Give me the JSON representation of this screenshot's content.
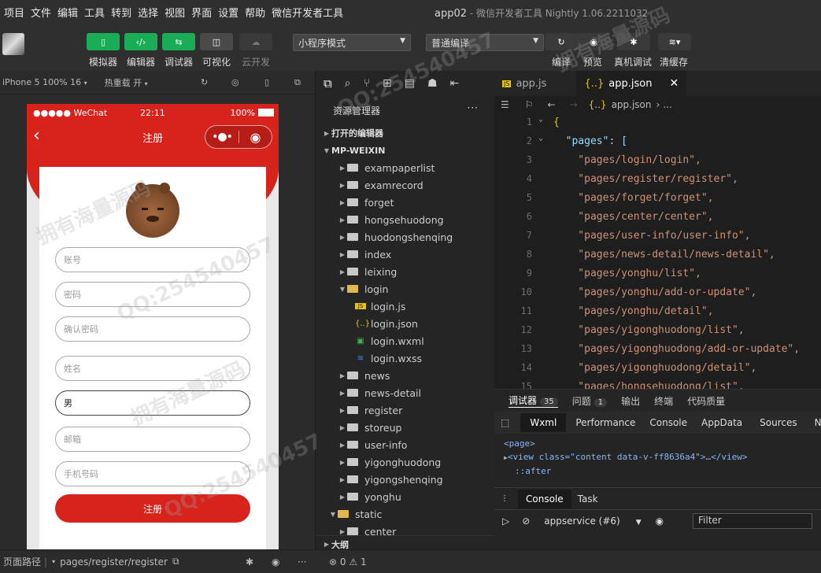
{
  "menu": [
    "项目",
    "文件",
    "编辑",
    "工具",
    "转到",
    "选择",
    "视图",
    "界面",
    "设置",
    "帮助",
    "微信开发者工具"
  ],
  "window_title": "app02",
  "window_subtitle": "- 微信开发者工具 Nightly 1.06.2211032",
  "toolbar": {
    "simulator": "模拟器",
    "editor": "编辑器",
    "debugger": "调试器",
    "visual": "可视化",
    "cloud": "云开发",
    "mode_select": "小程序模式",
    "compile_select": "普通编译",
    "compile": "编译",
    "preview": "预览",
    "real_debug": "真机调试",
    "clear_cache": "清缓存"
  },
  "simbar": {
    "device": "iPhone 5 100% 16",
    "hot_reload": "热重载 开"
  },
  "phone": {
    "carrier": "●●●●● WeChat",
    "time": "22:11",
    "battery": "100%",
    "page_title": "注册",
    "fields": [
      {
        "placeholder": "账号",
        "value": ""
      },
      {
        "placeholder": "密码",
        "value": ""
      },
      {
        "placeholder": "确认密码",
        "value": ""
      },
      {
        "placeholder": "姓名",
        "value": ""
      },
      {
        "placeholder": "",
        "value": "男"
      },
      {
        "placeholder": "邮箱",
        "value": ""
      },
      {
        "placeholder": "手机号码",
        "value": ""
      }
    ],
    "register_button": "注册"
  },
  "explorer": {
    "title": "资源管理器",
    "open_editors": "打开的编辑器",
    "root": "MP-WEIXIN",
    "outline": "大纲",
    "items": [
      {
        "name": "exampaperlist",
        "type": "folder",
        "level": 1
      },
      {
        "name": "examrecord",
        "type": "folder",
        "level": 1
      },
      {
        "name": "forget",
        "type": "folder",
        "level": 1
      },
      {
        "name": "hongsehuodong",
        "type": "folder",
        "level": 1
      },
      {
        "name": "huodongshenqing",
        "type": "folder",
        "level": 1
      },
      {
        "name": "index",
        "type": "folder",
        "level": 1
      },
      {
        "name": "leixing",
        "type": "folder",
        "level": 1
      },
      {
        "name": "login",
        "type": "folder-open",
        "level": 1
      },
      {
        "name": "login.js",
        "type": "js",
        "level": 2
      },
      {
        "name": "login.json",
        "type": "json",
        "level": 2
      },
      {
        "name": "login.wxml",
        "type": "wxml",
        "level": 2
      },
      {
        "name": "login.wxss",
        "type": "wxss",
        "level": 2
      },
      {
        "name": "news",
        "type": "folder",
        "level": 1
      },
      {
        "name": "news-detail",
        "type": "folder",
        "level": 1
      },
      {
        "name": "register",
        "type": "folder",
        "level": 1
      },
      {
        "name": "storeup",
        "type": "folder",
        "level": 1
      },
      {
        "name": "user-info",
        "type": "folder",
        "level": 1
      },
      {
        "name": "yigonghuodong",
        "type": "folder",
        "level": 1
      },
      {
        "name": "yigongshenqing",
        "type": "folder",
        "level": 1
      },
      {
        "name": "yonghu",
        "type": "folder",
        "level": 1
      },
      {
        "name": "static",
        "type": "folder-open",
        "level": 0
      },
      {
        "name": "center",
        "type": "folder",
        "level": 1
      }
    ]
  },
  "editor": {
    "tabs": [
      {
        "name": "app.js",
        "active": false
      },
      {
        "name": "app.json",
        "active": true
      }
    ],
    "breadcrumb": "app.json",
    "breadcrumb_tail": "...",
    "lines": [
      {
        "n": "1",
        "text": "{"
      },
      {
        "n": "2",
        "text": "  \"pages\": ["
      },
      {
        "n": "3",
        "text": "    \"pages/login/login\","
      },
      {
        "n": "4",
        "text": "    \"pages/register/register\","
      },
      {
        "n": "5",
        "text": "    \"pages/forget/forget\","
      },
      {
        "n": "6",
        "text": "    \"pages/center/center\","
      },
      {
        "n": "7",
        "text": "    \"pages/user-info/user-info\","
      },
      {
        "n": "8",
        "text": "    \"pages/news-detail/news-detail\","
      },
      {
        "n": "9",
        "text": "    \"pages/yonghu/list\","
      },
      {
        "n": "10",
        "text": "    \"pages/yonghu/add-or-update\","
      },
      {
        "n": "11",
        "text": "    \"pages/yonghu/detail\","
      },
      {
        "n": "12",
        "text": "    \"pages/yigonghuodong/list\","
      },
      {
        "n": "13",
        "text": "    \"pages/yigonghuodong/add-or-update\","
      },
      {
        "n": "14",
        "text": "    \"pages/yigonghuodong/detail\","
      },
      {
        "n": "15",
        "text": "    \"pages/hongsehuodong/list\","
      }
    ]
  },
  "debugger": {
    "tab_debugger": "调试器",
    "debugger_count": "35",
    "tab_issues": "问题",
    "issues_count": "1",
    "tab_output": "输出",
    "tab_terminal": "终端",
    "tab_quality": "代码质量",
    "panels": [
      "Wxml",
      "Performance",
      "Console",
      "AppData",
      "Sources",
      "Net"
    ],
    "xml_line1": "<page>",
    "xml_line2": "<view class=\"content data-v-ff8636a4\">…</view>",
    "xml_line3": "::after",
    "console_tabs": [
      "Console",
      "Task"
    ],
    "context_select": "appservice (#6)",
    "filter_placeholder": "Filter"
  },
  "statusbar": {
    "page_path_label": "页面路径",
    "page_path": "pages/register/register",
    "errors": "0",
    "warnings": "1"
  },
  "watermarks": [
    "拥有海量源码",
    "QQ:254540457"
  ]
}
